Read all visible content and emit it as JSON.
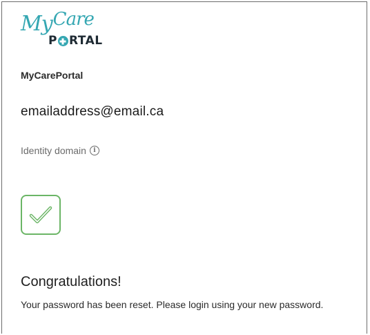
{
  "logo": {
    "script_my": "My",
    "script_care": "Care",
    "portal_p": "P",
    "portal_rest": "RTAL"
  },
  "app_name": "MyCarePortal",
  "email": "emailaddress@email.ca",
  "identity_domain": {
    "label": "Identity domain",
    "info_icon": "ⓘ"
  },
  "status_icon": "checkmark-icon",
  "colors": {
    "logo_teal": "#35a7b2",
    "logo_dark": "#1e2a33",
    "success_green": "#6bb566",
    "muted_text": "#6b6b6b"
  },
  "heading": "Congratulations!",
  "message": "Your password has been reset. Please login using your new password."
}
